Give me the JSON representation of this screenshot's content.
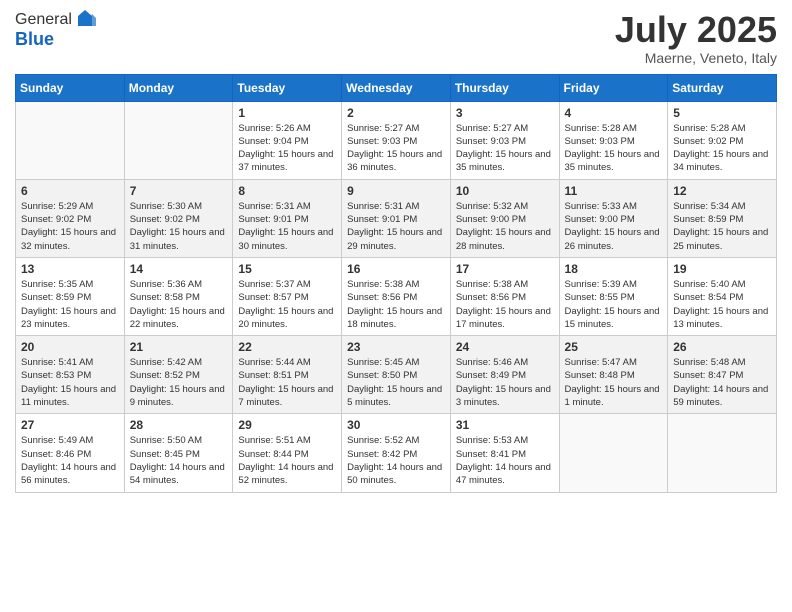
{
  "header": {
    "logo_general": "General",
    "logo_blue": "Blue",
    "month_title": "July 2025",
    "location": "Maerne, Veneto, Italy"
  },
  "days_of_week": [
    "Sunday",
    "Monday",
    "Tuesday",
    "Wednesday",
    "Thursday",
    "Friday",
    "Saturday"
  ],
  "weeks": [
    [
      {
        "num": "",
        "info": ""
      },
      {
        "num": "",
        "info": ""
      },
      {
        "num": "1",
        "info": "Sunrise: 5:26 AM\nSunset: 9:04 PM\nDaylight: 15 hours and 37 minutes."
      },
      {
        "num": "2",
        "info": "Sunrise: 5:27 AM\nSunset: 9:03 PM\nDaylight: 15 hours and 36 minutes."
      },
      {
        "num": "3",
        "info": "Sunrise: 5:27 AM\nSunset: 9:03 PM\nDaylight: 15 hours and 35 minutes."
      },
      {
        "num": "4",
        "info": "Sunrise: 5:28 AM\nSunset: 9:03 PM\nDaylight: 15 hours and 35 minutes."
      },
      {
        "num": "5",
        "info": "Sunrise: 5:28 AM\nSunset: 9:02 PM\nDaylight: 15 hours and 34 minutes."
      }
    ],
    [
      {
        "num": "6",
        "info": "Sunrise: 5:29 AM\nSunset: 9:02 PM\nDaylight: 15 hours and 32 minutes."
      },
      {
        "num": "7",
        "info": "Sunrise: 5:30 AM\nSunset: 9:02 PM\nDaylight: 15 hours and 31 minutes."
      },
      {
        "num": "8",
        "info": "Sunrise: 5:31 AM\nSunset: 9:01 PM\nDaylight: 15 hours and 30 minutes."
      },
      {
        "num": "9",
        "info": "Sunrise: 5:31 AM\nSunset: 9:01 PM\nDaylight: 15 hours and 29 minutes."
      },
      {
        "num": "10",
        "info": "Sunrise: 5:32 AM\nSunset: 9:00 PM\nDaylight: 15 hours and 28 minutes."
      },
      {
        "num": "11",
        "info": "Sunrise: 5:33 AM\nSunset: 9:00 PM\nDaylight: 15 hours and 26 minutes."
      },
      {
        "num": "12",
        "info": "Sunrise: 5:34 AM\nSunset: 8:59 PM\nDaylight: 15 hours and 25 minutes."
      }
    ],
    [
      {
        "num": "13",
        "info": "Sunrise: 5:35 AM\nSunset: 8:59 PM\nDaylight: 15 hours and 23 minutes."
      },
      {
        "num": "14",
        "info": "Sunrise: 5:36 AM\nSunset: 8:58 PM\nDaylight: 15 hours and 22 minutes."
      },
      {
        "num": "15",
        "info": "Sunrise: 5:37 AM\nSunset: 8:57 PM\nDaylight: 15 hours and 20 minutes."
      },
      {
        "num": "16",
        "info": "Sunrise: 5:38 AM\nSunset: 8:56 PM\nDaylight: 15 hours and 18 minutes."
      },
      {
        "num": "17",
        "info": "Sunrise: 5:38 AM\nSunset: 8:56 PM\nDaylight: 15 hours and 17 minutes."
      },
      {
        "num": "18",
        "info": "Sunrise: 5:39 AM\nSunset: 8:55 PM\nDaylight: 15 hours and 15 minutes."
      },
      {
        "num": "19",
        "info": "Sunrise: 5:40 AM\nSunset: 8:54 PM\nDaylight: 15 hours and 13 minutes."
      }
    ],
    [
      {
        "num": "20",
        "info": "Sunrise: 5:41 AM\nSunset: 8:53 PM\nDaylight: 15 hours and 11 minutes."
      },
      {
        "num": "21",
        "info": "Sunrise: 5:42 AM\nSunset: 8:52 PM\nDaylight: 15 hours and 9 minutes."
      },
      {
        "num": "22",
        "info": "Sunrise: 5:44 AM\nSunset: 8:51 PM\nDaylight: 15 hours and 7 minutes."
      },
      {
        "num": "23",
        "info": "Sunrise: 5:45 AM\nSunset: 8:50 PM\nDaylight: 15 hours and 5 minutes."
      },
      {
        "num": "24",
        "info": "Sunrise: 5:46 AM\nSunset: 8:49 PM\nDaylight: 15 hours and 3 minutes."
      },
      {
        "num": "25",
        "info": "Sunrise: 5:47 AM\nSunset: 8:48 PM\nDaylight: 15 hours and 1 minute."
      },
      {
        "num": "26",
        "info": "Sunrise: 5:48 AM\nSunset: 8:47 PM\nDaylight: 14 hours and 59 minutes."
      }
    ],
    [
      {
        "num": "27",
        "info": "Sunrise: 5:49 AM\nSunset: 8:46 PM\nDaylight: 14 hours and 56 minutes."
      },
      {
        "num": "28",
        "info": "Sunrise: 5:50 AM\nSunset: 8:45 PM\nDaylight: 14 hours and 54 minutes."
      },
      {
        "num": "29",
        "info": "Sunrise: 5:51 AM\nSunset: 8:44 PM\nDaylight: 14 hours and 52 minutes."
      },
      {
        "num": "30",
        "info": "Sunrise: 5:52 AM\nSunset: 8:42 PM\nDaylight: 14 hours and 50 minutes."
      },
      {
        "num": "31",
        "info": "Sunrise: 5:53 AM\nSunset: 8:41 PM\nDaylight: 14 hours and 47 minutes."
      },
      {
        "num": "",
        "info": ""
      },
      {
        "num": "",
        "info": ""
      }
    ]
  ]
}
